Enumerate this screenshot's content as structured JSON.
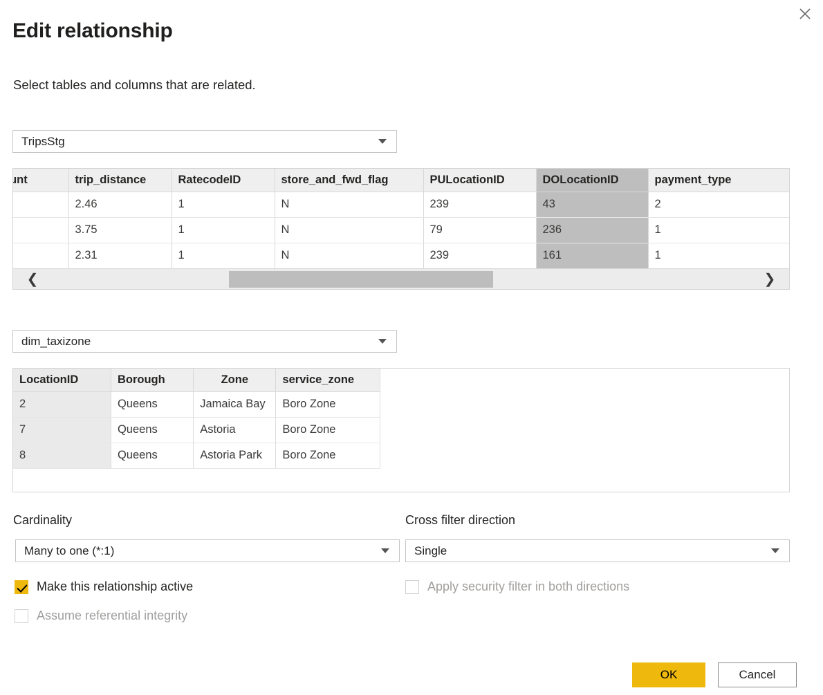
{
  "dialog": {
    "title": "Edit relationship",
    "subtitle": "Select tables and columns that are related.",
    "close_label": "Close"
  },
  "source": {
    "selected_table": "TripsStg",
    "selected_column": "DOLocationID",
    "columns": [
      "ger_count",
      "trip_distance",
      "RatecodeID",
      "store_and_fwd_flag",
      "PULocationID",
      "DOLocationID",
      "payment_type"
    ],
    "rows": [
      [
        "",
        "2.46",
        "1",
        "N",
        "239",
        "43",
        "2"
      ],
      [
        "",
        "3.75",
        "1",
        "N",
        "79",
        "236",
        "1"
      ],
      [
        "",
        "2.31",
        "1",
        "N",
        "239",
        "161",
        "1"
      ]
    ],
    "scrollbar": {
      "left_arrow": "❮",
      "right_arrow": "❯"
    }
  },
  "related": {
    "selected_table": "dim_taxizone",
    "selected_column": "LocationID",
    "columns": [
      "LocationID",
      "Borough",
      "Zone",
      "service_zone"
    ],
    "rows": [
      [
        "2",
        "Queens",
        "Jamaica Bay",
        "Boro Zone"
      ],
      [
        "7",
        "Queens",
        "Astoria",
        "Boro Zone"
      ],
      [
        "8",
        "Queens",
        "Astoria Park",
        "Boro Zone"
      ]
    ]
  },
  "options": {
    "cardinality_label": "Cardinality",
    "cardinality_value": "Many to one (*:1)",
    "crossfilter_label": "Cross filter direction",
    "crossfilter_value": "Single",
    "make_active_label": "Make this relationship active",
    "make_active_checked": true,
    "assume_referential_label": "Assume referential integrity",
    "assume_referential_checked": false,
    "assume_referential_disabled": true,
    "security_filter_label": "Apply security filter in both directions",
    "security_filter_checked": false,
    "security_filter_disabled": true
  },
  "footer": {
    "ok_label": "OK",
    "cancel_label": "Cancel"
  },
  "colors": {
    "accent": "#eeb80d",
    "header_bg": "#efefef",
    "selected_column_source": "#bebebe",
    "selected_column_related": "#eaeaea",
    "border": "#d4d4d4",
    "disabled_text": "#a19f9d"
  }
}
